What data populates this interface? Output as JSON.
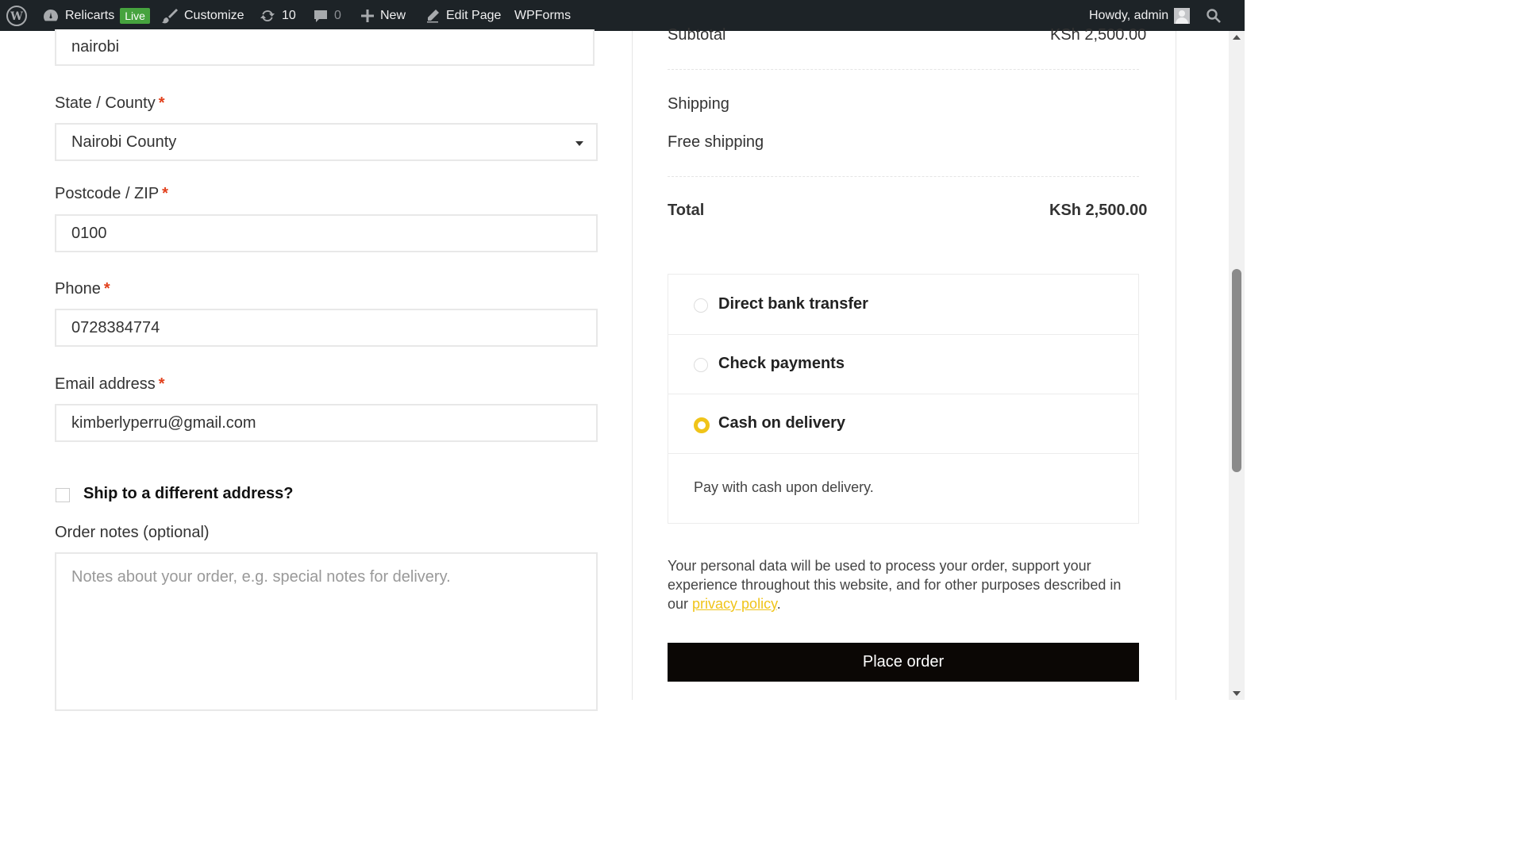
{
  "adminbar": {
    "site_name": "Relicarts",
    "live_badge": "Live",
    "customize": "Customize",
    "updates_count": "10",
    "comments_count": "0",
    "new": "New",
    "edit_page": "Edit Page",
    "wpforms": "WPForms",
    "greeting": "Howdy, admin"
  },
  "form": {
    "city_value": "nairobi",
    "state": {
      "label": "State / County",
      "value": "Nairobi County"
    },
    "postcode": {
      "label": "Postcode / ZIP",
      "value": "0100"
    },
    "phone": {
      "label": "Phone",
      "value": "0728384774"
    },
    "email": {
      "label": "Email address",
      "value": "kimberlyperru@gmail.com"
    },
    "required_mark": "*",
    "ship_different": "Ship to a different address?",
    "order_notes": {
      "label": "Order notes (optional)",
      "placeholder": "Notes about your order, e.g. special notes for delivery."
    }
  },
  "summary": {
    "subtotal_label": "Subtotal",
    "subtotal_value": "KSh 2,500.00",
    "shipping_label": "Shipping",
    "shipping_value": "Free shipping",
    "total_label": "Total",
    "total_value": "KSh 2,500.00"
  },
  "payment": {
    "methods": [
      {
        "label": "Direct bank transfer",
        "selected": false
      },
      {
        "label": "Check payments",
        "selected": false
      },
      {
        "label": "Cash on delivery",
        "selected": true
      }
    ],
    "description": "Pay with cash upon delivery."
  },
  "privacy": {
    "text_before": "Your personal data will be used to process your order, support your experience throughout this website, and for other purposes described in our ",
    "link_text": "privacy policy",
    "text_after": "."
  },
  "place_order": "Place order",
  "colors": {
    "accent": "#f0c419",
    "adminbar": "#1d2327",
    "live": "#46a33e",
    "button": "#0b0705"
  }
}
